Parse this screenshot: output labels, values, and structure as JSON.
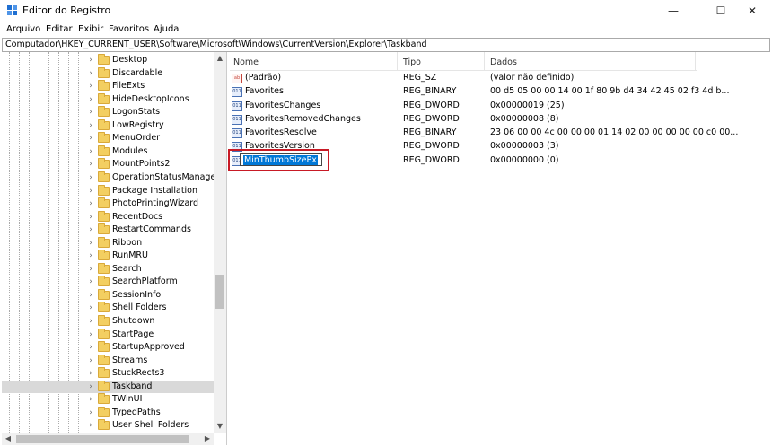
{
  "window": {
    "title": "Editor do Registro",
    "controls": {
      "minimize": "—",
      "maximize": "☐",
      "close": "✕"
    }
  },
  "menu": [
    "Arquivo",
    "Editar",
    "Exibir",
    "Favoritos",
    "Ajuda"
  ],
  "address": "Computador\\HKEY_CURRENT_USER\\Software\\Microsoft\\Windows\\CurrentVersion\\Explorer\\Taskband",
  "tree": {
    "items": [
      {
        "label": "Desktop"
      },
      {
        "label": "Discardable"
      },
      {
        "label": "FileExts"
      },
      {
        "label": "HideDesktopIcons"
      },
      {
        "label": "LogonStats"
      },
      {
        "label": "LowRegistry"
      },
      {
        "label": "MenuOrder"
      },
      {
        "label": "Modules"
      },
      {
        "label": "MountPoints2"
      },
      {
        "label": "OperationStatusManager"
      },
      {
        "label": "Package Installation"
      },
      {
        "label": "PhotoPrintingWizard"
      },
      {
        "label": "RecentDocs"
      },
      {
        "label": "RestartCommands"
      },
      {
        "label": "Ribbon"
      },
      {
        "label": "RunMRU"
      },
      {
        "label": "Search"
      },
      {
        "label": "SearchPlatform"
      },
      {
        "label": "SessionInfo"
      },
      {
        "label": "Shell Folders"
      },
      {
        "label": "Shutdown"
      },
      {
        "label": "StartPage"
      },
      {
        "label": "StartupApproved"
      },
      {
        "label": "Streams"
      },
      {
        "label": "StuckRects3"
      },
      {
        "label": "Taskband",
        "selected": true
      },
      {
        "label": "TWinUI"
      },
      {
        "label": "TypedPaths"
      },
      {
        "label": "User Shell Folders"
      }
    ]
  },
  "columns": {
    "name": "Nome",
    "type": "Tipo",
    "data": "Dados"
  },
  "values": [
    {
      "name": "(Padrão)",
      "type": "REG_SZ",
      "data": "(valor não definido)",
      "icon": "ab"
    },
    {
      "name": "Favorites",
      "type": "REG_BINARY",
      "data": "00 d5 05 00 00 14 00 1f 80 9b d4 34 42 45 02 f3 4d b...",
      "icon": "bin"
    },
    {
      "name": "FavoritesChanges",
      "type": "REG_DWORD",
      "data": "0x00000019 (25)",
      "icon": "bin"
    },
    {
      "name": "FavoritesRemovedChanges",
      "type": "REG_DWORD",
      "data": "0x00000008 (8)",
      "icon": "bin"
    },
    {
      "name": "FavoritesResolve",
      "type": "REG_BINARY",
      "data": "23 06 00 00 4c 00 00 00 01 14 02 00 00 00 00 00 c0 00...",
      "icon": "bin"
    },
    {
      "name": "FavoritesVersion",
      "type": "REG_DWORD",
      "data": "0x00000003 (3)",
      "icon": "bin"
    },
    {
      "name": "MinThumbSizePx",
      "type": "REG_DWORD",
      "data": "0x00000000 (0)",
      "icon": "bin",
      "editing": true
    }
  ]
}
